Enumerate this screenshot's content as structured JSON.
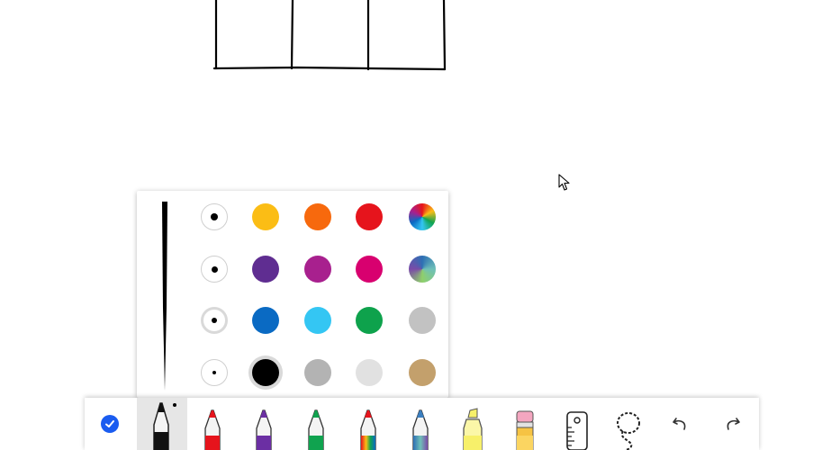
{
  "flyout": {
    "sizes": [
      {
        "name": "size-1",
        "selected": false
      },
      {
        "name": "size-2",
        "selected": false
      },
      {
        "name": "size-3",
        "selected": true
      },
      {
        "name": "size-4",
        "selected": false
      }
    ],
    "colors": [
      [
        "#fbbd15",
        "#f7690d",
        "#e6141c",
        "rainbow"
      ],
      [
        "#5f2d91",
        "#a8208e",
        "#d8006f",
        "galaxy"
      ],
      [
        "#0a6ac3",
        "#34c6f3",
        "#0ea24c",
        "#c2c2c2"
      ],
      [
        "#000000",
        "#b3b3b3",
        "#e1e1e1",
        "#c3a06c"
      ]
    ],
    "selected_color": "#000000"
  },
  "toolbar": {
    "tools": [
      {
        "name": "done-button",
        "icon": "checkmark-icon"
      },
      {
        "name": "pen-black",
        "icon": "pen-icon",
        "color": "#111111",
        "active": true
      },
      {
        "name": "pen-red",
        "icon": "pen-icon",
        "color": "#e6141c"
      },
      {
        "name": "pen-purple",
        "icon": "pen-icon",
        "color": "#6b2fa3"
      },
      {
        "name": "pen-green",
        "icon": "pen-icon",
        "color": "#10a34f"
      },
      {
        "name": "pen-rainbow",
        "icon": "pen-icon",
        "color": "rainbow"
      },
      {
        "name": "pen-galaxy",
        "icon": "pen-icon",
        "color": "galaxy"
      },
      {
        "name": "highlighter",
        "icon": "highlighter-icon",
        "color": "#f7f06a"
      },
      {
        "name": "pencil-eraser",
        "icon": "pencil-icon",
        "color": "#f6c343"
      },
      {
        "name": "ruler",
        "icon": "ruler-icon"
      },
      {
        "name": "lasso-select",
        "icon": "lasso-icon"
      },
      {
        "name": "undo",
        "icon": "undo-icon"
      },
      {
        "name": "redo",
        "icon": "redo-icon"
      }
    ]
  }
}
